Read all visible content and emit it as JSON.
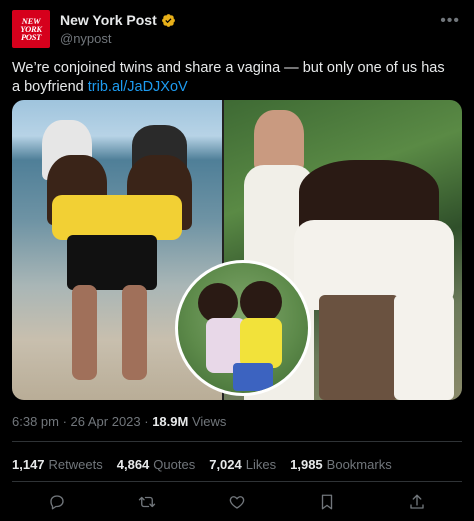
{
  "account": {
    "avatar_text": [
      "NEW",
      "YORK",
      "POST"
    ],
    "display_name": "New York Post",
    "handle": "@nypost",
    "verified_color": "#e8b019"
  },
  "tweet": {
    "text": "We’re conjoined twins and share a vagina — but only one of us has a boyfriend ",
    "link": "trib.al/JaDJXoV"
  },
  "meta": {
    "time_date": "6:38 pm · 26 Apr 2023 · ",
    "views_count": "18.9M",
    "views_label": " Views"
  },
  "stats": {
    "retweets_count": "1,147",
    "retweets_label": "Retweets",
    "quotes_count": "4,864",
    "quotes_label": "Quotes",
    "likes_count": "7,024",
    "likes_label": "Likes",
    "bookmarks_count": "1,985",
    "bookmarks_label": "Bookmarks"
  },
  "actions": [
    "reply-icon",
    "retweet-icon",
    "like-icon",
    "bookmark-icon",
    "share-icon"
  ],
  "colors": {
    "background": "#000000",
    "text": "#e7e9ea",
    "muted": "#71767b",
    "link": "#1d9bf0",
    "divider": "#2f3336",
    "brand_red": "#d6001c"
  }
}
